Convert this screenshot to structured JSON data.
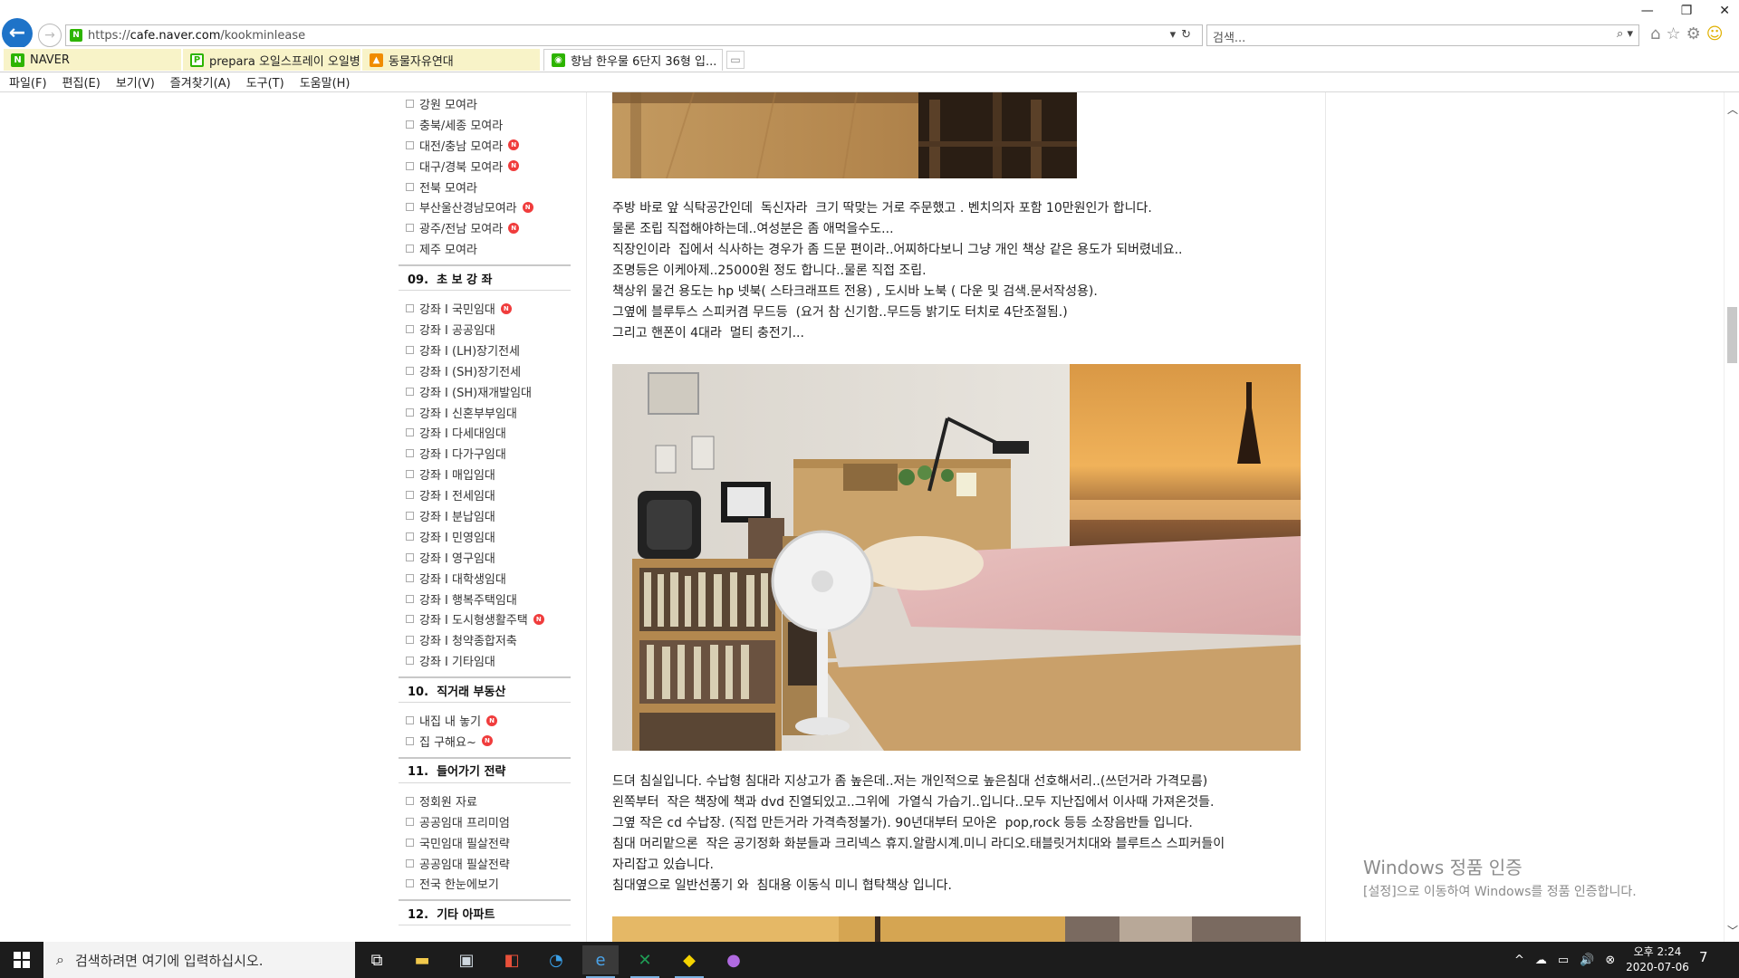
{
  "browser": {
    "url_prefix": "https://",
    "url_domain": "cafe.naver.com",
    "url_path": "/kookminlease",
    "url_tools": "▾↻",
    "search_placeholder": "검색...",
    "search_tools": "⌕ ▾",
    "tool_icons": [
      "⌂",
      "☆",
      "⚙",
      "☺"
    ],
    "window_controls": [
      "—",
      "❐",
      "✕"
    ],
    "tabs": [
      {
        "label": "NAVER",
        "icon": "naver-icon",
        "color": "#2db400"
      },
      {
        "label": "prepara 오일스프레이 오일병 ...",
        "icon": "shopping-icon",
        "color": "#2db400"
      },
      {
        "label": "동물자유연대",
        "icon": "org-icon",
        "color": "#f08c00"
      },
      {
        "label": "향남 한우물 6단지 36형 입...",
        "icon": "cafe-icon",
        "color": "#2db400"
      }
    ],
    "tab_close": "✕",
    "menu": [
      "파일(F)",
      "편집(E)",
      "보기(V)",
      "즐겨찾기(A)",
      "도구(T)",
      "도움말(H)"
    ]
  },
  "sidebar": {
    "badge_text": "N",
    "items_a": [
      {
        "label": "강원 모여라",
        "new": false
      },
      {
        "label": "충북/세종 모여라",
        "new": false
      },
      {
        "label": "대전/충남 모여라",
        "new": true
      },
      {
        "label": "대구/경북 모여라",
        "new": true
      },
      {
        "label": "전북 모여라",
        "new": false
      },
      {
        "label": "부산울산경남모여라",
        "new": true
      },
      {
        "label": "광주/전남 모여라",
        "new": true
      },
      {
        "label": "제주 모여라",
        "new": false
      }
    ],
    "head_09": "09.  초 보 강 좌",
    "items_09": [
      {
        "label": "강좌 I 국민임대",
        "new": true
      },
      {
        "label": "강좌 I 공공임대",
        "new": false
      },
      {
        "label": "강좌 I (LH)장기전세",
        "new": false
      },
      {
        "label": "강좌 I (SH)장기전세",
        "new": false
      },
      {
        "label": "강좌 I (SH)재개발임대",
        "new": false
      },
      {
        "label": "강좌 I 신혼부부임대",
        "new": false
      },
      {
        "label": "강좌 I 다세대임대",
        "new": false
      },
      {
        "label": "강좌 I 다가구임대",
        "new": false
      },
      {
        "label": "강좌 I 매입임대",
        "new": false
      },
      {
        "label": "강좌 I 전세임대",
        "new": false
      },
      {
        "label": "강좌 I 분납임대",
        "new": false
      },
      {
        "label": "강좌 I 민영임대",
        "new": false
      },
      {
        "label": "강좌 I 영구임대",
        "new": false
      },
      {
        "label": "강좌 I 대학생임대",
        "new": false
      },
      {
        "label": "강좌 I 행복주택임대",
        "new": false
      },
      {
        "label": "강좌 I 도시형생활주택",
        "new": true
      },
      {
        "label": "강좌 I 청약종합저축",
        "new": false
      },
      {
        "label": "강좌 I 기타임대",
        "new": false
      }
    ],
    "head_10": "10.  직거래 부동산",
    "items_10": [
      {
        "label": "내집 내 놓기",
        "new": true
      },
      {
        "label": "집 구해요~",
        "new": true
      }
    ],
    "head_11": "11.  들어가기 전략",
    "items_11": [
      {
        "label": "정회원 자료",
        "new": false
      },
      {
        "label": "공공임대 프리미엄",
        "new": false
      },
      {
        "label": "국민임대 필살전략",
        "new": false
      },
      {
        "label": "공공임대 필살전략",
        "new": false
      },
      {
        "label": "전국 한눈에보기",
        "new": false
      }
    ],
    "head_12": "12.  기타 아파트"
  },
  "article": {
    "para1": [
      "주방 바로 앞 식탁공간인데  독신자라  크기 딱맞는 거로 주문했고 . 벤치의자 포함 10만원인가 합니다.",
      "물론 조립 직접해야하는데..여성분은 좀 애먹을수도...",
      "직장인이라  집에서 식사하는 경우가 좀 드문 편이라..어찌하다보니 그냥 개인 책상 같은 용도가 되버렸네요..",
      "조명등은 이케아제..25000원 정도 합니다..물론 직접 조립.",
      "책상위 물건 용도는 hp 넷북( 스타크래프트 전용) , 도시바 노북 ( 다운 및 검색.문서작성용).",
      "그옆에 블루투스 스피커겸 무드등  (요거 참 신기함..무드등 밝기도 터치로 4단조절됨.)",
      "그리고 핸폰이 4대라  멀티 충전기..."
    ],
    "para2": [
      "드뎌 침실입니다. 수납형 침대라 지상고가 좀 높은데..저는 개인적으로 높은침대 선호해서리..(쓰던거라 가격모름)",
      "왼쪽부터  작은 책장에 책과 dvd 진열되있고..그위에  가열식 가습기..입니다..모두 지난집에서 이사때 가져온것들.",
      "그옆 작은 cd 수납장. (직접 만든거라 가격측정불가). 90년대부터 모아온  pop,rock 등등 소장음반들 입니다.",
      "침대 머리맡으론  작은 공기정화 화분들과 크리넥스 휴지.알람시계.미니 라디오.태블릿거치대와 블루트스 스피커들이",
      "자리잡고 있습니다.",
      "침대옆으로 일반선풍기 와  침대용 이동식 미니 협탁책상 입니다."
    ]
  },
  "watermark": {
    "title": "Windows 정품 인증",
    "subtitle": "[설정]으로 이동하여 Windows를 정품 인증합니다."
  },
  "taskbar": {
    "search_placeholder": "검색하려면 여기에 입력하십시오.",
    "time": "오후 2:24",
    "date": "2020-07-06",
    "notification_count": "7",
    "tray_icons": [
      "^",
      "☁",
      "▭",
      "🔊",
      "⊗"
    ]
  }
}
